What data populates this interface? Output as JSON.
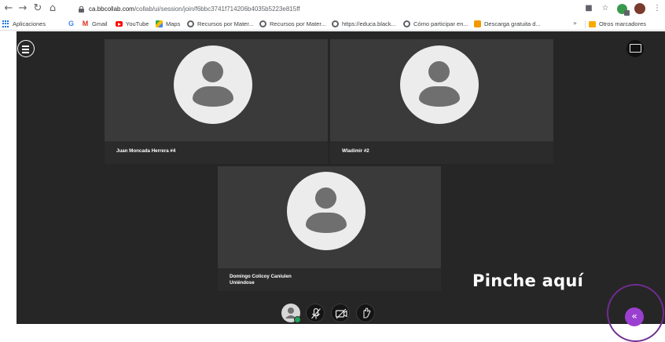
{
  "browser": {
    "url_host": "ca.bbcollab.com",
    "url_path": "/collab/ui/session/join/f6bbc3741f714206b4035b5223e815ff",
    "nav_icons": [
      "back-arrow-icon",
      "forward-arrow-icon",
      "reload-icon",
      "home-icon"
    ],
    "bookmarks": [
      {
        "label": "Aplicaciones",
        "icon": "apps-grid-icon"
      },
      {
        "label": "Gmail",
        "icon": "gmail-icon"
      },
      {
        "label": "YouTube",
        "icon": "youtube-icon"
      },
      {
        "label": "Maps",
        "icon": "maps-icon"
      },
      {
        "label": "Recursos por Mater...",
        "icon": "globe-icon"
      },
      {
        "label": "Recursos por Mater...",
        "icon": "globe-icon"
      },
      {
        "label": "https://educa.black...",
        "icon": "globe-icon"
      },
      {
        "label": "Cómo participar en...",
        "icon": "globe-icon"
      },
      {
        "label": "Descarga gratuita d...",
        "icon": "download-site-icon"
      }
    ],
    "bookmarks_overflow": "»",
    "other_bookmarks": "Otros marcadores"
  },
  "session": {
    "participants": [
      {
        "name": "Juan Moncada Herrera #4"
      },
      {
        "name": "Wladimir #2"
      },
      {
        "name": "Domingo Colicoy Caniulen",
        "status": "Uniéndose"
      }
    ],
    "controls": [
      "my-status-avatar",
      "microphone-off-icon",
      "camera-off-icon",
      "hand-raise-icon"
    ],
    "status_color": "#1fa35a",
    "panel_button": "«",
    "accent_color": "#9b3fd0"
  },
  "annotation": {
    "label": "Pinche aquí",
    "ring_color": "#6f2d91"
  }
}
